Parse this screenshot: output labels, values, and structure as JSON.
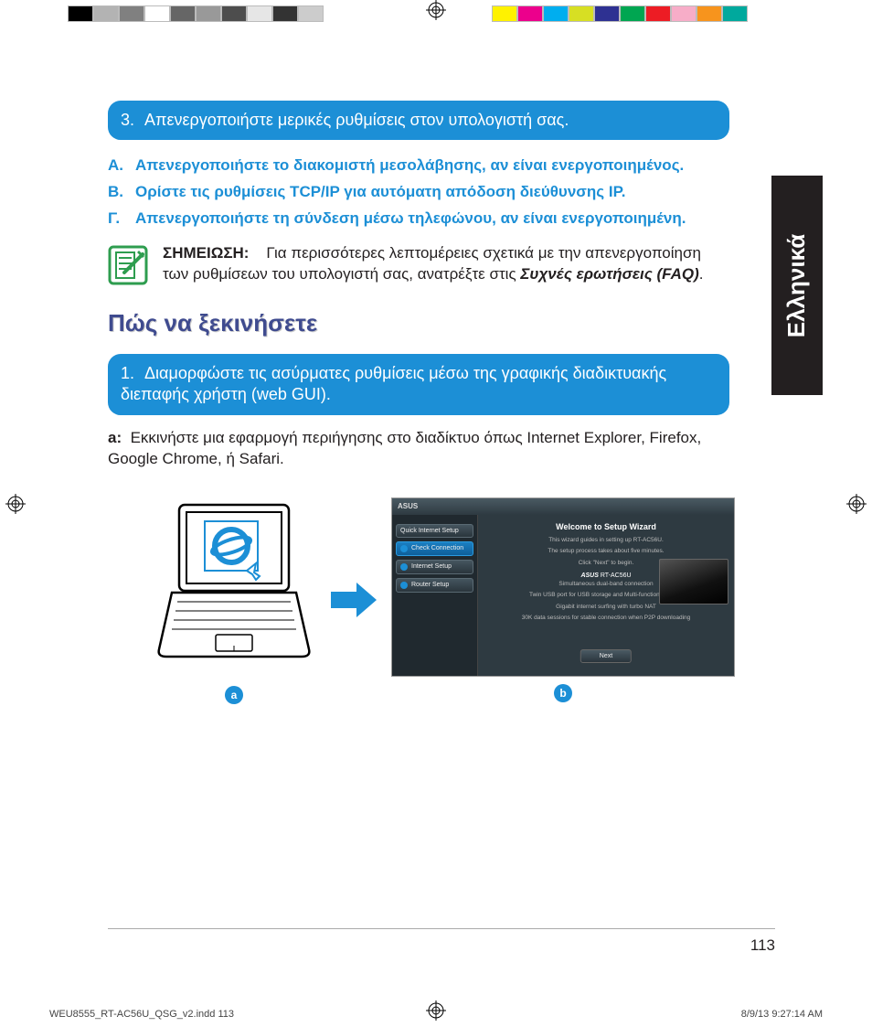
{
  "side_tab": "Ελληνικά",
  "callout3": {
    "num": "3.",
    "text": "Απενεργοποιήστε μερικές ρυθμίσεις στον υπολογιστή σας."
  },
  "letters": {
    "a": {
      "lt": "A.",
      "txt": "Απενεργοποιήστε το διακομιστή μεσολάβησης, αν είναι ενεργοποιημένος."
    },
    "b": {
      "lt": "B.",
      "txt": " Ορίστε τις ρυθμίσεις TCP/IP για αυτόματη απόδοση διεύθυνσης IP."
    },
    "c": {
      "lt": "Γ.",
      "txt": "Απενεργοποιήστε τη σύνδεση μέσω τηλεφώνου, αν είναι ενεργοποιημένη."
    }
  },
  "note": {
    "label": "ΣΗΜΕΙΩΣΗ:",
    "body": "Για περισσότερες λεπτομέρειες σχετικά με την απενεργοποίηση των ρυθμίσεων του υπολογιστή σας, ανατρέξτε στις ",
    "faq": "Συχνές ερωτήσεις (FAQ)",
    "tail": "."
  },
  "section_title": "Πώς να ξεκινήσετε",
  "callout1": {
    "num": "1.",
    "text": "Διαμορφώστε τις ασύρματες ρυθμίσεις μέσω της γραφικής διαδικτυακής διεπαφής χρήστη (web GUI)."
  },
  "step_a": {
    "label": "a:",
    "text": "Εκκινήστε μια εφαρμογή περιήγησης στο διαδίκτυο όπως Internet  Explorer, Firefox, Google Chrome, ή Safari."
  },
  "wizard": {
    "brand": "ASUS",
    "header": "Welcome to Setup Wizard",
    "side_items": [
      "Quick Internet Setup",
      "Check Connection",
      "Internet Setup",
      "Router Setup"
    ],
    "line1": "This wizard guides in setting up RT-AC56U.",
    "line2": "The setup process takes about five minutes.",
    "line3": "Click \"Next\" to begin.",
    "model_brand": "ASUS",
    "model": "RT-AC56U",
    "feat1": "Simultaneous dual-band connection",
    "feat2": "Twin USB port for USB storage and Multi-functional printer",
    "feat3": "Gigabit internet surfing with turbo NAT",
    "feat4": "30K data sessions for stable connection when P2P downloading",
    "next": "Next"
  },
  "badges": {
    "a": "a",
    "b": "b"
  },
  "page_number": "113",
  "slug": {
    "file": "WEU8555_RT-AC56U_QSG_v2.indd   113",
    "stamp": "8/9/13   9:27:14 AM"
  },
  "swatches_left": [
    "#000000",
    "#b3b3b3",
    "#808080",
    "#ffffff",
    "#666666",
    "#999999",
    "#4d4d4d",
    "#e6e6e6",
    "#333333",
    "#cccccc"
  ],
  "swatches_right": [
    "#fff200",
    "#ec008c",
    "#00aeef",
    "#d7df23",
    "#2e3192",
    "#00a651",
    "#ed1c24",
    "#f7adc8",
    "#f7941d",
    "#00a99d"
  ]
}
